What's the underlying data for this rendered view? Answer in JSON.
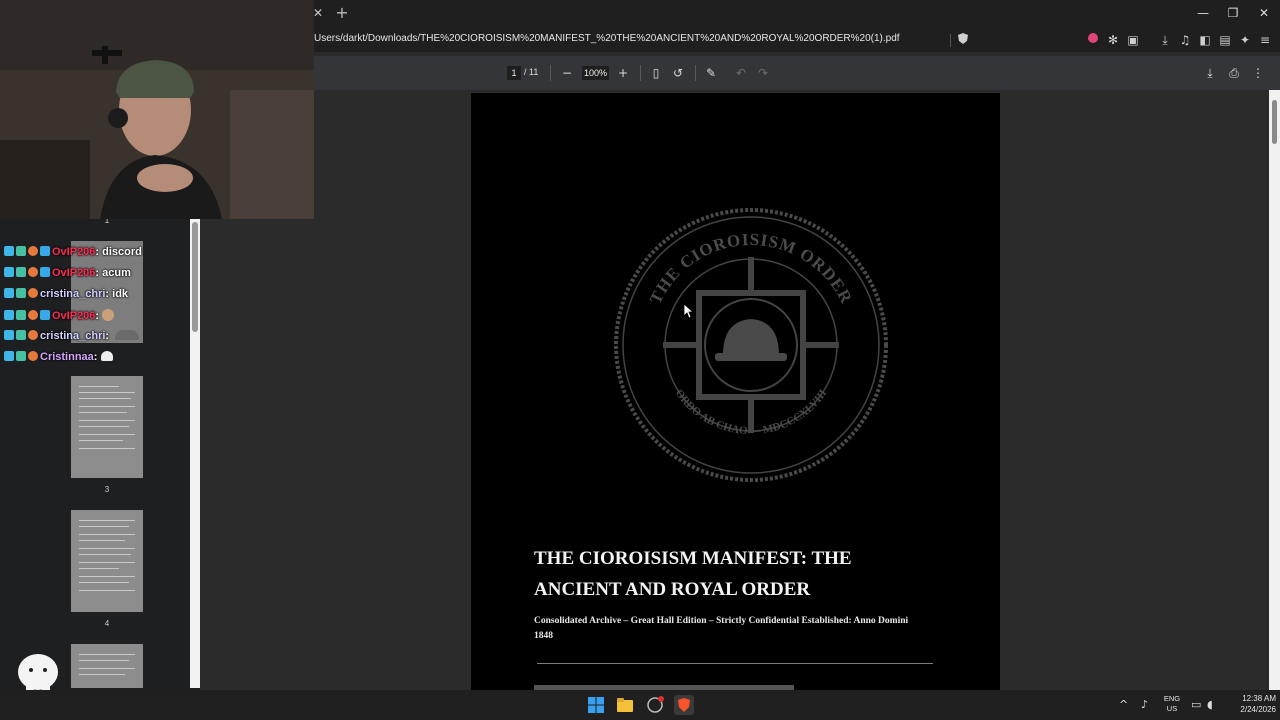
{
  "browser": {
    "tab_close": "✕",
    "new_tab": "+",
    "url": "Users/darkt/Downloads/THE%20CIOROISISM%20MANIFEST_%20THE%20ANCIENT%20AND%20ROYAL%20ORDER%20(1).pdf",
    "window_controls": [
      "—",
      "❐",
      "✕"
    ]
  },
  "pdf_toolbar": {
    "page_current": "1",
    "page_total": "/ 11",
    "zoom": "100%"
  },
  "sidebar": {
    "page_numbers": [
      "1",
      "3",
      "4"
    ]
  },
  "document": {
    "seal_text_top": "THE CIOROISISM ORDER",
    "seal_text_bottom": "ORDO AB CHAO — MDCCCXLVIII",
    "title": "THE CIOROISISM MANIFEST: THE ANCIENT AND ROYAL ORDER",
    "subtitle": "Consolidated Archive – Great Hall Edition – Strictly Confidential Established: Anno Domini 1848"
  },
  "chat": {
    "messages": [
      {
        "user": "OvIP206",
        "text": ": discord",
        "color": "#ff2d55",
        "badges": 4
      },
      {
        "user": "OvIP206",
        "text": ": acum",
        "color": "#ff2d55",
        "badges": 4
      },
      {
        "user": "cristina_chri",
        "text": ": idk",
        "color": "#d0d0ff",
        "badges": 3
      },
      {
        "user": "OvIP206",
        "text": ":",
        "color": "#ff2d55",
        "badges": 4
      },
      {
        "user": "cristina_chri",
        "text": ":",
        "color": "#d0d0ff",
        "badges": 3
      },
      {
        "user": "Cristinnaa",
        "text": ":",
        "color": "#d6a4ff",
        "badges": 3
      }
    ]
  },
  "taskbar": {
    "lang_line1": "ENG",
    "lang_line2": "US",
    "time": "12:38 AM",
    "date": "2/24/2026"
  },
  "colors": {
    "page_bg": "#000000",
    "viewer_bg": "#2b2b2b",
    "toolbar_bg": "#333538",
    "accent_user": "#ff2d55"
  }
}
